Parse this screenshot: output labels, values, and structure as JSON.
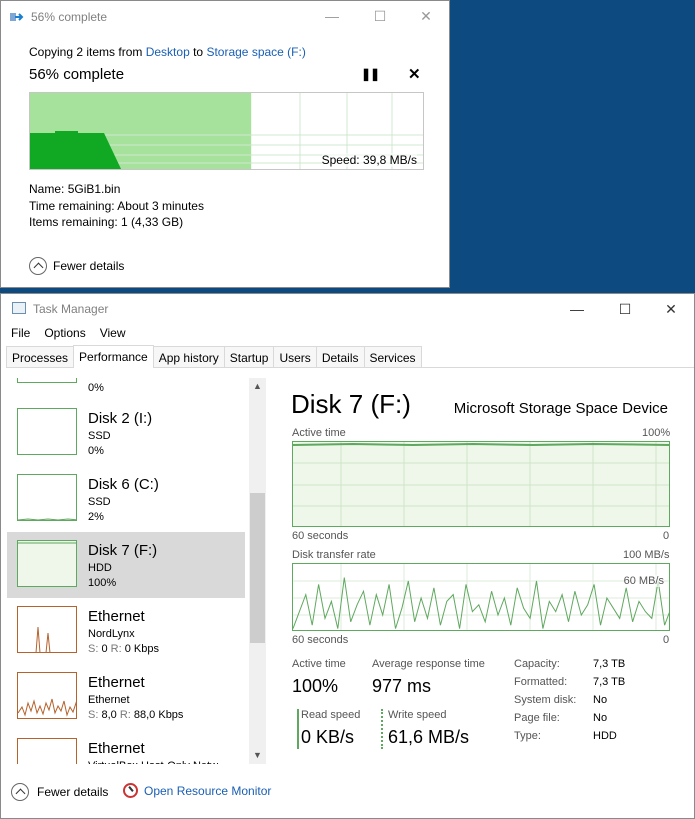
{
  "copy_dialog": {
    "title": "56% complete",
    "copying_prefix": "Copying 2 items from",
    "source": "Desktop",
    "to_word": "to",
    "destination": "Storage space (F:)",
    "percent_text": "56% complete",
    "progress_percent": 56,
    "speed_text": "Speed: 39,8 MB/s",
    "name_label": "Name:",
    "name_value": "5GiB1.bin",
    "time_label": "Time remaining:",
    "time_value": "About 3 minutes",
    "items_label": "Items remaining:",
    "items_value": "1 (4,33 GB)",
    "fewer_details": "Fewer details",
    "colors": {
      "progress_fill": "#a7e29c",
      "speed_fill": "#11a824",
      "link": "#1a5fb4"
    }
  },
  "task_manager": {
    "title": "Task Manager",
    "menu": [
      "File",
      "Options",
      "View"
    ],
    "tabs": [
      "Processes",
      "Performance",
      "App history",
      "Startup",
      "Users",
      "Details",
      "Services"
    ],
    "active_tab": "Performance",
    "sidebar": [
      {
        "name": "",
        "type": "",
        "value": "0%"
      },
      {
        "name": "Disk 2 (I:)",
        "type": "SSD",
        "value": "0%"
      },
      {
        "name": "Disk 6 (C:)",
        "type": "SSD",
        "value": "2%"
      },
      {
        "name": "Disk 7 (F:)",
        "type": "HDD",
        "value": "100%",
        "selected": true
      },
      {
        "name": "Ethernet",
        "type": "NordLynx",
        "send_label": "S:",
        "send": "0",
        "recv_label": "R:",
        "recv": "0 Kbps"
      },
      {
        "name": "Ethernet",
        "type": "Ethernet",
        "send_label": "S:",
        "send": "8,0",
        "recv_label": "R:",
        "recv": "88,0 Kbps"
      },
      {
        "name": "Ethernet",
        "type": "VirtualBox Host-Only Netw"
      }
    ],
    "detail": {
      "title": "Disk 7 (F:)",
      "model": "Microsoft Storage Space Device",
      "active_time_label": "Active time",
      "active_time_max": "100%",
      "x_left": "60 seconds",
      "x_right": "0",
      "transfer_label": "Disk transfer rate",
      "transfer_max": "100 MB/s",
      "transfer_mid": "60 MB/s",
      "x_left2": "60 seconds",
      "x_right2": "0",
      "active_time_stat_label": "Active time",
      "active_time_stat": "100%",
      "avg_resp_label": "Average response time",
      "avg_resp": "977 ms",
      "read_label": "Read speed",
      "read_value": "0 KB/s",
      "write_label": "Write speed",
      "write_value": "61,6 MB/s",
      "props": [
        {
          "k": "Capacity:",
          "v": "7,3 TB"
        },
        {
          "k": "Formatted:",
          "v": "7,3 TB"
        },
        {
          "k": "System disk:",
          "v": "No"
        },
        {
          "k": "Page file:",
          "v": "No"
        },
        {
          "k": "Type:",
          "v": "HDD"
        }
      ],
      "transfer_rate_mbps": [
        5,
        30,
        55,
        10,
        70,
        20,
        45,
        5,
        80,
        15,
        40,
        60,
        10,
        55,
        25,
        70,
        5,
        35,
        75,
        15,
        50,
        20,
        65,
        10,
        45,
        55,
        5,
        70,
        30,
        40,
        15,
        60,
        25,
        50,
        10,
        65,
        35,
        20,
        75,
        5,
        45,
        30,
        55,
        15,
        60,
        25,
        40,
        70,
        10,
        50,
        35,
        20,
        65,
        15,
        45,
        30,
        20,
        75,
        10,
        35
      ]
    },
    "footer": {
      "fewer_details": "Fewer details",
      "resource_monitor": "Open Resource Monitor"
    },
    "colors": {
      "disk_green": "#5fa85f",
      "ethernet": "#b5622c",
      "selected_bg": "#d9d9d9"
    }
  }
}
